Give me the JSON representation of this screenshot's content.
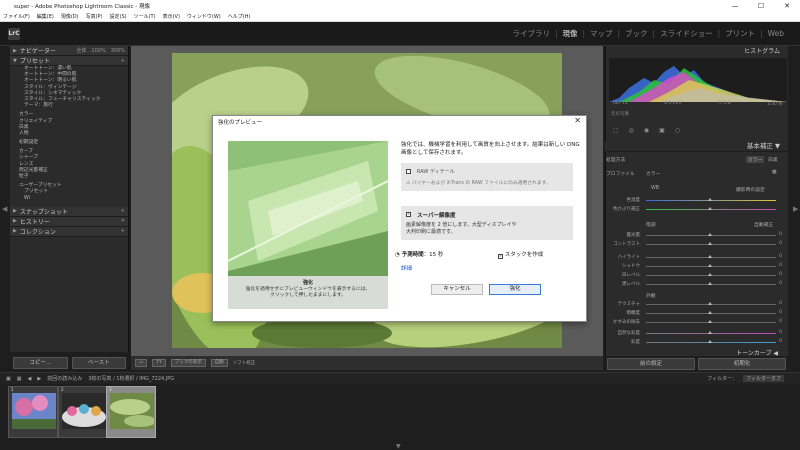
{
  "window": {
    "title": "super - Adobe Photoshop Lightroom Classic - 現像",
    "minimize": "—",
    "maximize": "☐",
    "close": "✕"
  },
  "menu": [
    "ファイル(F)",
    "編集(E)",
    "現像(D)",
    "写真(P)",
    "設定(S)",
    "ツール(T)",
    "表示(V)",
    "ウィンドウ(W)",
    "ヘルプ(H)"
  ],
  "logo": "LrC",
  "modules": [
    {
      "label": "ライブラリ",
      "active": false
    },
    {
      "label": "現像",
      "active": true
    },
    {
      "label": "マップ",
      "active": false
    },
    {
      "label": "ブック",
      "active": false
    },
    {
      "label": "スライドショー",
      "active": false
    },
    {
      "label": "プリント",
      "active": false
    },
    {
      "label": "Web",
      "active": false
    }
  ],
  "left_panel": {
    "navigator": {
      "title": "ナビゲーター",
      "zoom_options": "全体　100%　300%"
    },
    "presets": {
      "title": "プリセット",
      "items": [
        "オートトーン：濃い肌",
        "オートトーン：中間の肌",
        "オートトーン：明るい肌",
        "スタイル：ヴィンテージ",
        "スタイル：シネマティック",
        "スタイル：フューチャリスティック",
        "テーマ：旅行",
        "カラー",
        "クリエイティブ",
        "白黒",
        "人物",
        "初期設定",
        "カーブ",
        "シャープ",
        "レンズ",
        "周辺光量補正",
        "粒子",
        "ユーザープリセット",
        "プリセット",
        "Wi"
      ]
    },
    "snapshots": "スナップショット",
    "history": "ヒストリー",
    "collections": "コレクション",
    "copy_button": "コピー...",
    "paste_button": "ペースト"
  },
  "toolbar": {
    "softproof": "ソフト校正",
    "display_label": "ブックの表示",
    "sample": "自動"
  },
  "right_panel": {
    "histogram_title": "ヒストグラム",
    "histo_info": [
      "ISO 11",
      "4.5 mm",
      "f / 1.8",
      "1/30 秒"
    ],
    "original": "元の写真",
    "basic_title": "基本補正",
    "treatment": "処理方法",
    "color": "カラー",
    "bw": "白黒",
    "profile": "プロファイル",
    "profile_value": "カラー",
    "wb": "WB",
    "wb_value": "撮影時の設定",
    "temp": "色温度",
    "tint": "色かぶり補正",
    "tone": "階調",
    "auto": "自動補正",
    "exposure": "露光量",
    "contrast": "コントラスト",
    "highlights": "ハイライト",
    "shadows": "シャドウ",
    "whites": "白レベル",
    "blacks": "黒レベル",
    "presence": "外観",
    "texture": "テクスチャ",
    "clarity": "明瞭度",
    "dehaze": "かすみの除去",
    "vibrance": "自然な彩度",
    "saturation": "彩度",
    "tone_curve": "トーンカーブ",
    "prev_button": "前の設定",
    "reset_button": "初期化"
  },
  "filmstrip": {
    "source": "前回の読み込み",
    "count": "3枚の写真 / 1枚選択 / IMG_7224.JPG",
    "filter_label": "フィルター：",
    "filter_value": "フィルターオフ",
    "thumb_numbers": [
      "1",
      "2",
      "3"
    ]
  },
  "dialog": {
    "title": "強化のプレビュー",
    "close": "✕",
    "description": "強化では、機械学習を利用して画質を向上させます。結果は新しい DNG 画像として保存されます。",
    "raw_label": "RAW ディテール",
    "raw_warning": "バイヤーおよび X-Trans の RAW ファイルにのみ適用されます。",
    "sr_label": "スーパー解像度",
    "sr_desc_1": "画素解像度を 2 倍にします。大型ディスプレイや",
    "sr_desc_2": "大判印刷に最適です。",
    "estimate_label": "予測時間",
    "estimate_value": "15 秒",
    "stack": "スタックを作成",
    "detail_link": "詳細",
    "caption_title": "強化",
    "caption_1": "強化を適用せずにプレビューウィンドウを表示するには、",
    "caption_2": "クリックして押したままにします。",
    "cancel": "キャンセル",
    "ok": "強化"
  }
}
